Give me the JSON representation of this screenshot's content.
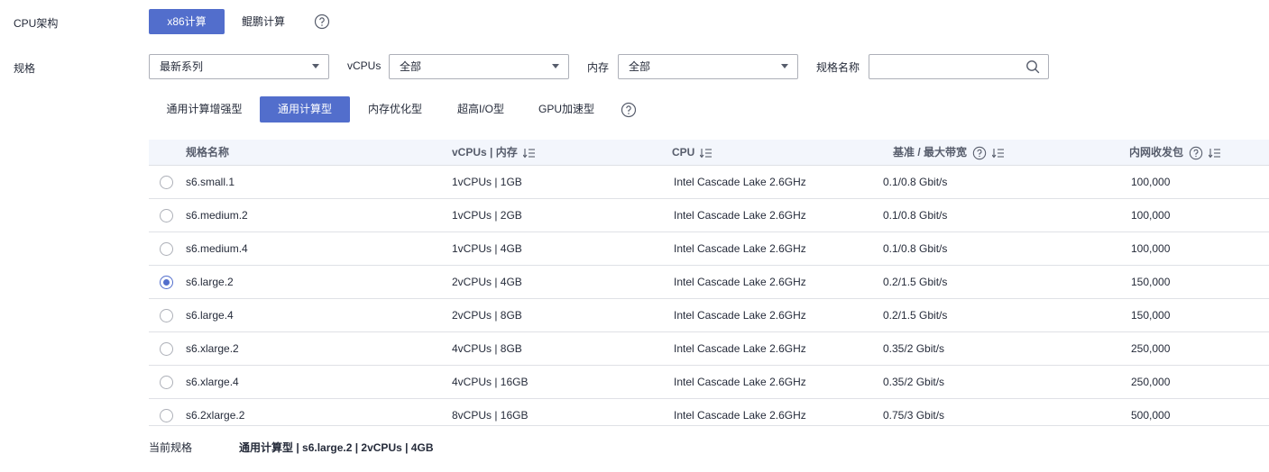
{
  "cpu_arch": {
    "label": "CPU架构",
    "options": [
      "x86计算",
      "鲲鹏计算"
    ],
    "selected": "x86计算"
  },
  "spec_filter": {
    "label": "规格",
    "series_select": "最新系列",
    "vcpus_label": "vCPUs",
    "vcpus_select": "全部",
    "memory_label": "内存",
    "memory_select": "全部",
    "name_label": "规格名称",
    "name_placeholder": ""
  },
  "type_tabs": [
    "通用计算增强型",
    "通用计算型",
    "内存优化型",
    "超高I/O型",
    "GPU加速型"
  ],
  "selected_tab": "通用计算型",
  "table": {
    "headers": {
      "name": "规格名称",
      "vcpu_mem": "vCPUs | 内存",
      "cpu": "CPU",
      "bandwidth": "基准 / 最大带宽",
      "pps": "内网收发包"
    },
    "rows": [
      {
        "name": "s6.small.1",
        "vcpu_mem": "1vCPUs | 1GB",
        "cpu": "Intel Cascade Lake 2.6GHz",
        "bandwidth": "0.1/0.8 Gbit/s",
        "pps": "100,000",
        "selected": false
      },
      {
        "name": "s6.medium.2",
        "vcpu_mem": "1vCPUs | 2GB",
        "cpu": "Intel Cascade Lake 2.6GHz",
        "bandwidth": "0.1/0.8 Gbit/s",
        "pps": "100,000",
        "selected": false
      },
      {
        "name": "s6.medium.4",
        "vcpu_mem": "1vCPUs | 4GB",
        "cpu": "Intel Cascade Lake 2.6GHz",
        "bandwidth": "0.1/0.8 Gbit/s",
        "pps": "100,000",
        "selected": false
      },
      {
        "name": "s6.large.2",
        "vcpu_mem": "2vCPUs | 4GB",
        "cpu": "Intel Cascade Lake 2.6GHz",
        "bandwidth": "0.2/1.5 Gbit/s",
        "pps": "150,000",
        "selected": true
      },
      {
        "name": "s6.large.4",
        "vcpu_mem": "2vCPUs | 8GB",
        "cpu": "Intel Cascade Lake 2.6GHz",
        "bandwidth": "0.2/1.5 Gbit/s",
        "pps": "150,000",
        "selected": false
      },
      {
        "name": "s6.xlarge.2",
        "vcpu_mem": "4vCPUs | 8GB",
        "cpu": "Intel Cascade Lake 2.6GHz",
        "bandwidth": "0.35/2 Gbit/s",
        "pps": "250,000",
        "selected": false
      },
      {
        "name": "s6.xlarge.4",
        "vcpu_mem": "4vCPUs | 16GB",
        "cpu": "Intel Cascade Lake 2.6GHz",
        "bandwidth": "0.35/2 Gbit/s",
        "pps": "250,000",
        "selected": false
      },
      {
        "name": "s6.2xlarge.2",
        "vcpu_mem": "8vCPUs | 16GB",
        "cpu": "Intel Cascade Lake 2.6GHz",
        "bandwidth": "0.75/3 Gbit/s",
        "pps": "500,000",
        "selected": false
      }
    ]
  },
  "current_spec": {
    "label": "当前规格",
    "value": "通用计算型 | s6.large.2 | 2vCPUs | 4GB"
  },
  "icons": {
    "help": "help-circle-icon",
    "search": "search-icon",
    "sort": "sort-icon",
    "dropdown": "chevron-down-icon"
  },
  "colors": {
    "accent": "#526ecc",
    "border": "#adb0b8",
    "header_bg": "#f3f6fc",
    "text": "#252b3a"
  }
}
